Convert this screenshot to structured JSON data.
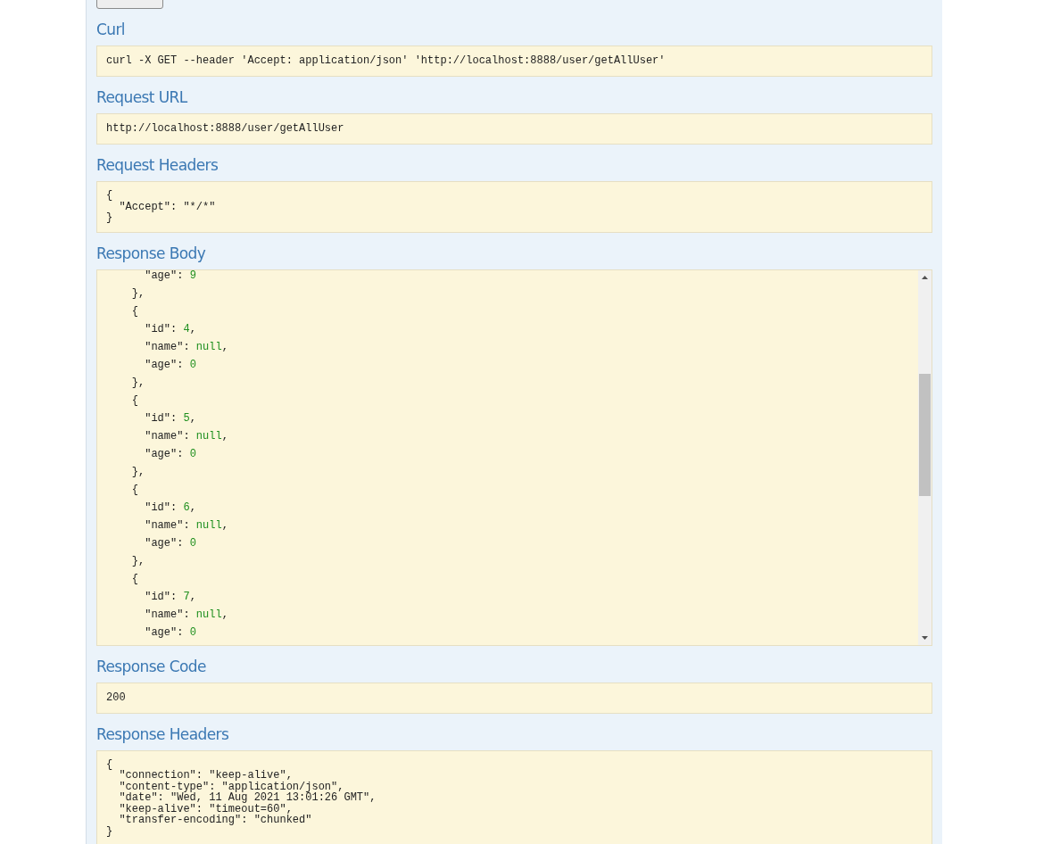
{
  "sections": [
    {
      "kind": "plain",
      "heading": "Curl",
      "lines": [
        "curl -X GET --header 'Accept: application/json' 'http://localhost:8888/user/getAllUser'"
      ]
    },
    {
      "kind": "plain",
      "heading": "Request URL",
      "lines": [
        "http://localhost:8888/user/getAllUser"
      ]
    },
    {
      "kind": "compact",
      "heading": "Request Headers",
      "lines": [
        "{",
        "  \"Accept\": \"*/*\"",
        "}"
      ]
    },
    {
      "kind": "json",
      "heading": "Response Body",
      "json_lines": [
        {
          "key": "      \"age\": ",
          "value": "9"
        },
        {
          "key": "    },"
        },
        {
          "key": "    {"
        },
        {
          "key": "      \"id\": ",
          "value": "4",
          "suffix": ","
        },
        {
          "key": "      \"name\": ",
          "value": "null",
          "suffix": ","
        },
        {
          "key": "      \"age\": ",
          "value": "0"
        },
        {
          "key": "    },"
        },
        {
          "key": "    {"
        },
        {
          "key": "      \"id\": ",
          "value": "5",
          "suffix": ","
        },
        {
          "key": "      \"name\": ",
          "value": "null",
          "suffix": ","
        },
        {
          "key": "      \"age\": ",
          "value": "0"
        },
        {
          "key": "    },"
        },
        {
          "key": "    {"
        },
        {
          "key": "      \"id\": ",
          "value": "6",
          "suffix": ","
        },
        {
          "key": "      \"name\": ",
          "value": "null",
          "suffix": ","
        },
        {
          "key": "      \"age\": ",
          "value": "0"
        },
        {
          "key": "    },"
        },
        {
          "key": "    {"
        },
        {
          "key": "      \"id\": ",
          "value": "7",
          "suffix": ","
        },
        {
          "key": "      \"name\": ",
          "value": "null",
          "suffix": ","
        },
        {
          "key": "      \"age\": ",
          "value": "0"
        }
      ]
    },
    {
      "kind": "plain",
      "heading": "Response Code",
      "lines": [
        "200"
      ]
    },
    {
      "kind": "compact",
      "heading": "Response Headers",
      "lines": [
        "{",
        "  \"connection\": \"keep-alive\",",
        "  \"content-type\": \"application/json\",",
        "  \"date\": \"Wed, 11 Aug 2021 13:01:26 GMT\",",
        "  \"keep-alive\": \"timeout=60\",",
        "  \"transfer-encoding\": \"chunked\"",
        "}"
      ]
    }
  ]
}
